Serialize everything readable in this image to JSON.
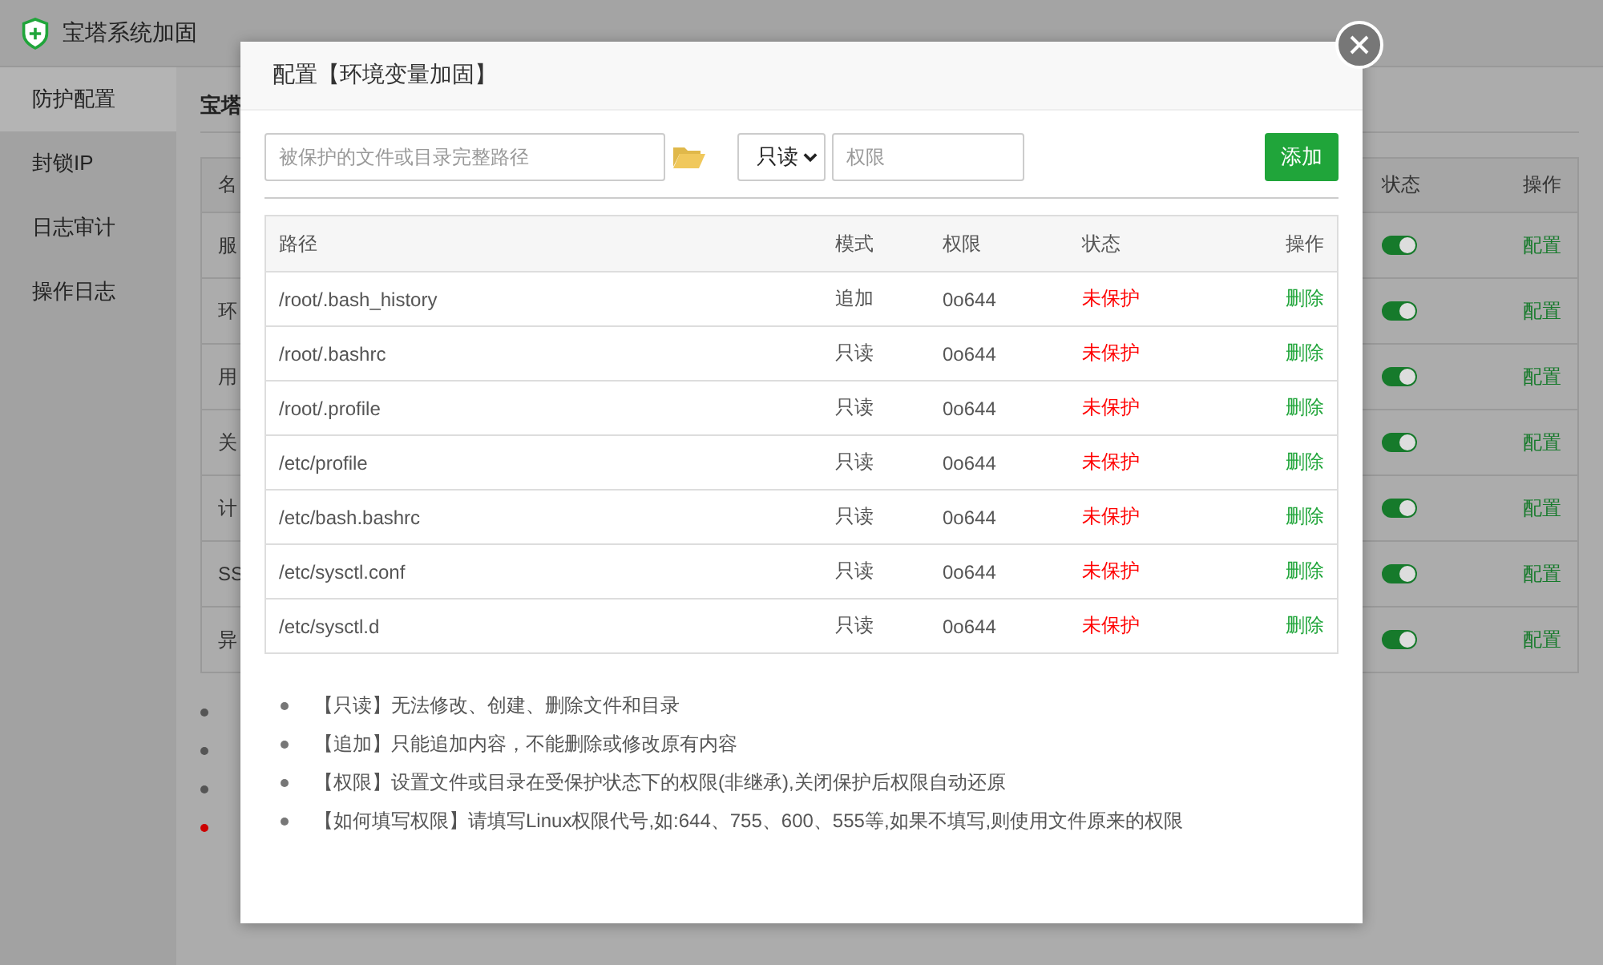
{
  "app": {
    "title": "宝塔系统加固"
  },
  "sidebar": {
    "items": [
      {
        "label": "防护配置",
        "selected": true
      },
      {
        "label": "封锁IP",
        "selected": false
      },
      {
        "label": "日志审计",
        "selected": false
      },
      {
        "label": "操作日志",
        "selected": false
      }
    ]
  },
  "background": {
    "section_title": "宝塔",
    "table": {
      "columns": [
        "名",
        "状态",
        "操作"
      ],
      "rows": [
        {
          "name": "服",
          "on": true,
          "action": "配置"
        },
        {
          "name": "环",
          "on": true,
          "action": "配置"
        },
        {
          "name": "用",
          "on": true,
          "action": "配置"
        },
        {
          "name": "关",
          "on": true,
          "action": "配置"
        },
        {
          "name": "计",
          "on": true,
          "action": "配置"
        },
        {
          "name": "SS",
          "on": true,
          "action": "配置"
        },
        {
          "name": "异",
          "on": true,
          "action": "配置"
        }
      ]
    },
    "notes": [
      {
        "color": "#555555"
      },
      {
        "color": "#555555"
      },
      {
        "color": "#555555"
      },
      {
        "color": "#cc0000"
      }
    ]
  },
  "dialog": {
    "title": "配置【环境变量加固】",
    "path_field": {
      "placeholder": "被保护的文件或目录完整路径"
    },
    "mode_select": {
      "value": "只读"
    },
    "permission_field": {
      "placeholder": "权限"
    },
    "add_button": "添加",
    "table": {
      "columns": [
        "路径",
        "模式",
        "权限",
        "状态",
        "操作"
      ],
      "rows": [
        {
          "path": "/root/.bash_history",
          "mode": "追加",
          "permission": "0o644",
          "status": "未保护",
          "protected": false,
          "action": "删除"
        },
        {
          "path": "/root/.bashrc",
          "mode": "只读",
          "permission": "0o644",
          "status": "未保护",
          "protected": false,
          "action": "删除"
        },
        {
          "path": "/root/.profile",
          "mode": "只读",
          "permission": "0o644",
          "status": "未保护",
          "protected": false,
          "action": "删除"
        },
        {
          "path": "/etc/profile",
          "mode": "只读",
          "permission": "0o644",
          "status": "未保护",
          "protected": false,
          "action": "删除"
        },
        {
          "path": "/etc/bash.bashrc",
          "mode": "只读",
          "permission": "0o644",
          "status": "未保护",
          "protected": false,
          "action": "删除"
        },
        {
          "path": "/etc/sysctl.conf",
          "mode": "只读",
          "permission": "0o644",
          "status": "未保护",
          "protected": false,
          "action": "删除"
        },
        {
          "path": "/etc/sysctl.d",
          "mode": "只读",
          "permission": "0o644",
          "status": "未保护",
          "protected": false,
          "action": "删除"
        }
      ]
    },
    "notes": [
      "【只读】无法修改、创建、删除文件和目录",
      "【追加】只能追加内容，不能删除或修改原有内容",
      "【权限】设置文件或目录在受保护状态下的权限(非继承),关闭保护后权限自动还原",
      "【如何填写权限】请填写Linux权限代号,如:644、755、600、555等,如果不填写,则使用文件原来的权限"
    ]
  }
}
